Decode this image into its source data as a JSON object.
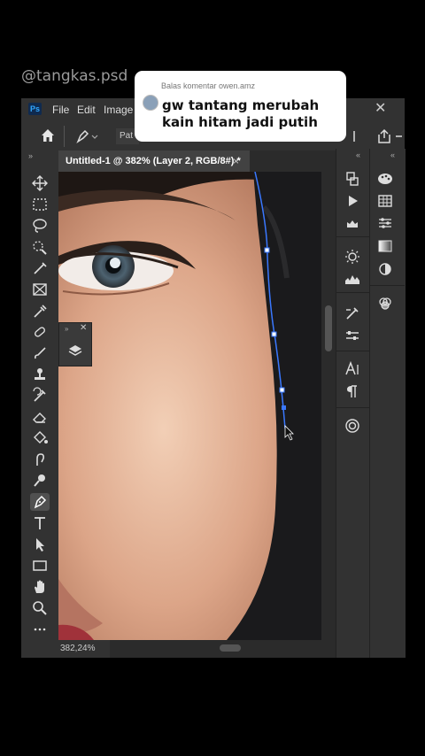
{
  "watermark": "@tangkas.psd",
  "app": {
    "logo": "Ps",
    "menu": [
      "File",
      "Edit",
      "Image"
    ],
    "close_glyph": "✕"
  },
  "options": {
    "path_mode": "Pat"
  },
  "document": {
    "tab_title": "Untitled-1 @ 382% (Layer 2, RGB/8#) *",
    "tab_close": "×",
    "zoom_status": "382,24%"
  },
  "comment": {
    "header": "Balas komentar owen.amz",
    "text": "gw tantang merubah kain hitam jadi putih"
  },
  "toolbar": {
    "collapse": "»",
    "tools": [
      "move-tool-icon",
      "marquee-tool-icon",
      "lasso-tool-icon",
      "quick-select-icon",
      "brush-stroke-icon",
      "crop-icon",
      "eyedropper-icon",
      "healing-brush-icon",
      "brush-icon",
      "stamp-icon",
      "history-brush-icon",
      "eraser-icon",
      "paint-bucket-icon",
      "smudge-icon",
      "dodge-icon",
      "pen-tool-icon",
      "type-tool-icon",
      "path-select-icon",
      "rectangle-icon",
      "hand-icon",
      "zoom-icon",
      "more-tools-icon"
    ],
    "active_tool": "pen-tool-icon"
  },
  "colors": {
    "ui_bg": "#323232",
    "canvas_bg": "#2b2b2b",
    "path_blue": "#3a78ff",
    "ps_blue": "#31a8ff"
  }
}
